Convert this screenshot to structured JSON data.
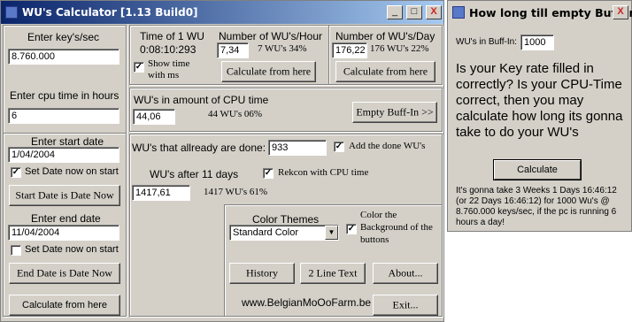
{
  "main_window": {
    "title": "WU's Calculator     [1.13 Build0]",
    "min_label": "_",
    "max_label": "□",
    "close_label": "X"
  },
  "keys": {
    "label": "Enter key's/sec",
    "value": "8.760.000"
  },
  "cpu": {
    "label": "Enter cpu time in hours",
    "value": "6"
  },
  "start": {
    "label": "Enter start date",
    "value": "1/04/2004",
    "checkbox_label": "Set Date now on start",
    "checked_mark": "✓",
    "button_label": "Start Date is Date Now"
  },
  "end": {
    "label": "Enter end date",
    "value": "11/04/2004",
    "checkbox_label": "Set Date now on start",
    "button_label": "End Date is Date Now"
  },
  "calculate_bottom_label": "Calculate from here",
  "time1wu": {
    "label": "Time of 1 WU",
    "value": "0:08:10:293",
    "show_ms_line1": "Show time",
    "show_ms_line2": "with ms",
    "checked_mark": "✓"
  },
  "per_hour": {
    "label": "Number of WU's/Hour",
    "value": "7,34",
    "text": "7 WU's 34%",
    "button_label": "Calculate from here"
  },
  "per_day": {
    "label": "Number of WU's/Day",
    "value": "176,22",
    "text": "176 WU's 22%",
    "button_label": "Calculate from here"
  },
  "cpu_amount": {
    "label": "WU's in amount of CPU time",
    "value": "44,06",
    "text": "44 WU's 06%"
  },
  "empty_buffin_button": "Empty Buff-In >>",
  "done": {
    "label": "WU's that allready are done:",
    "value": "933",
    "checkbox_label": "Add the done WU's",
    "checked_mark": "✓"
  },
  "after": {
    "label": "WU's after 11 days",
    "value": "1417,61",
    "text": "1417 WU's 61%",
    "checkbox_label": "Rekcon with CPU time",
    "checked_mark": "✓"
  },
  "themes": {
    "label": "Color Themes",
    "selected": "Standard Color",
    "checkbox_line1": "Color the",
    "checkbox_line2": "Background of the",
    "checkbox_line3": "buttons",
    "checked_mark": "✓"
  },
  "buttons": {
    "history": "History",
    "two_line": "2 Line Text",
    "about": "About...",
    "exit": "Exit..."
  },
  "website": "www.BelgianMoOoFarm.be",
  "side_window": {
    "title": "How long till empty Buff-In",
    "close_label": "X",
    "buffin_label": "WU's in Buff-In:",
    "buffin_value": "1000",
    "question": "Is your Key rate filled in correctly? Is your CPU-Time correct, then you may calculate how long its gonna take to do your WU's",
    "calculate_label": "Calculate",
    "result": "It's gonna take 3 Weeks 1 Days 16:46:12 (or 22 Days 16:46:12) for 1000 Wu's @ 8.760.000 keys/sec, if the pc is running 6 hours a day!"
  }
}
